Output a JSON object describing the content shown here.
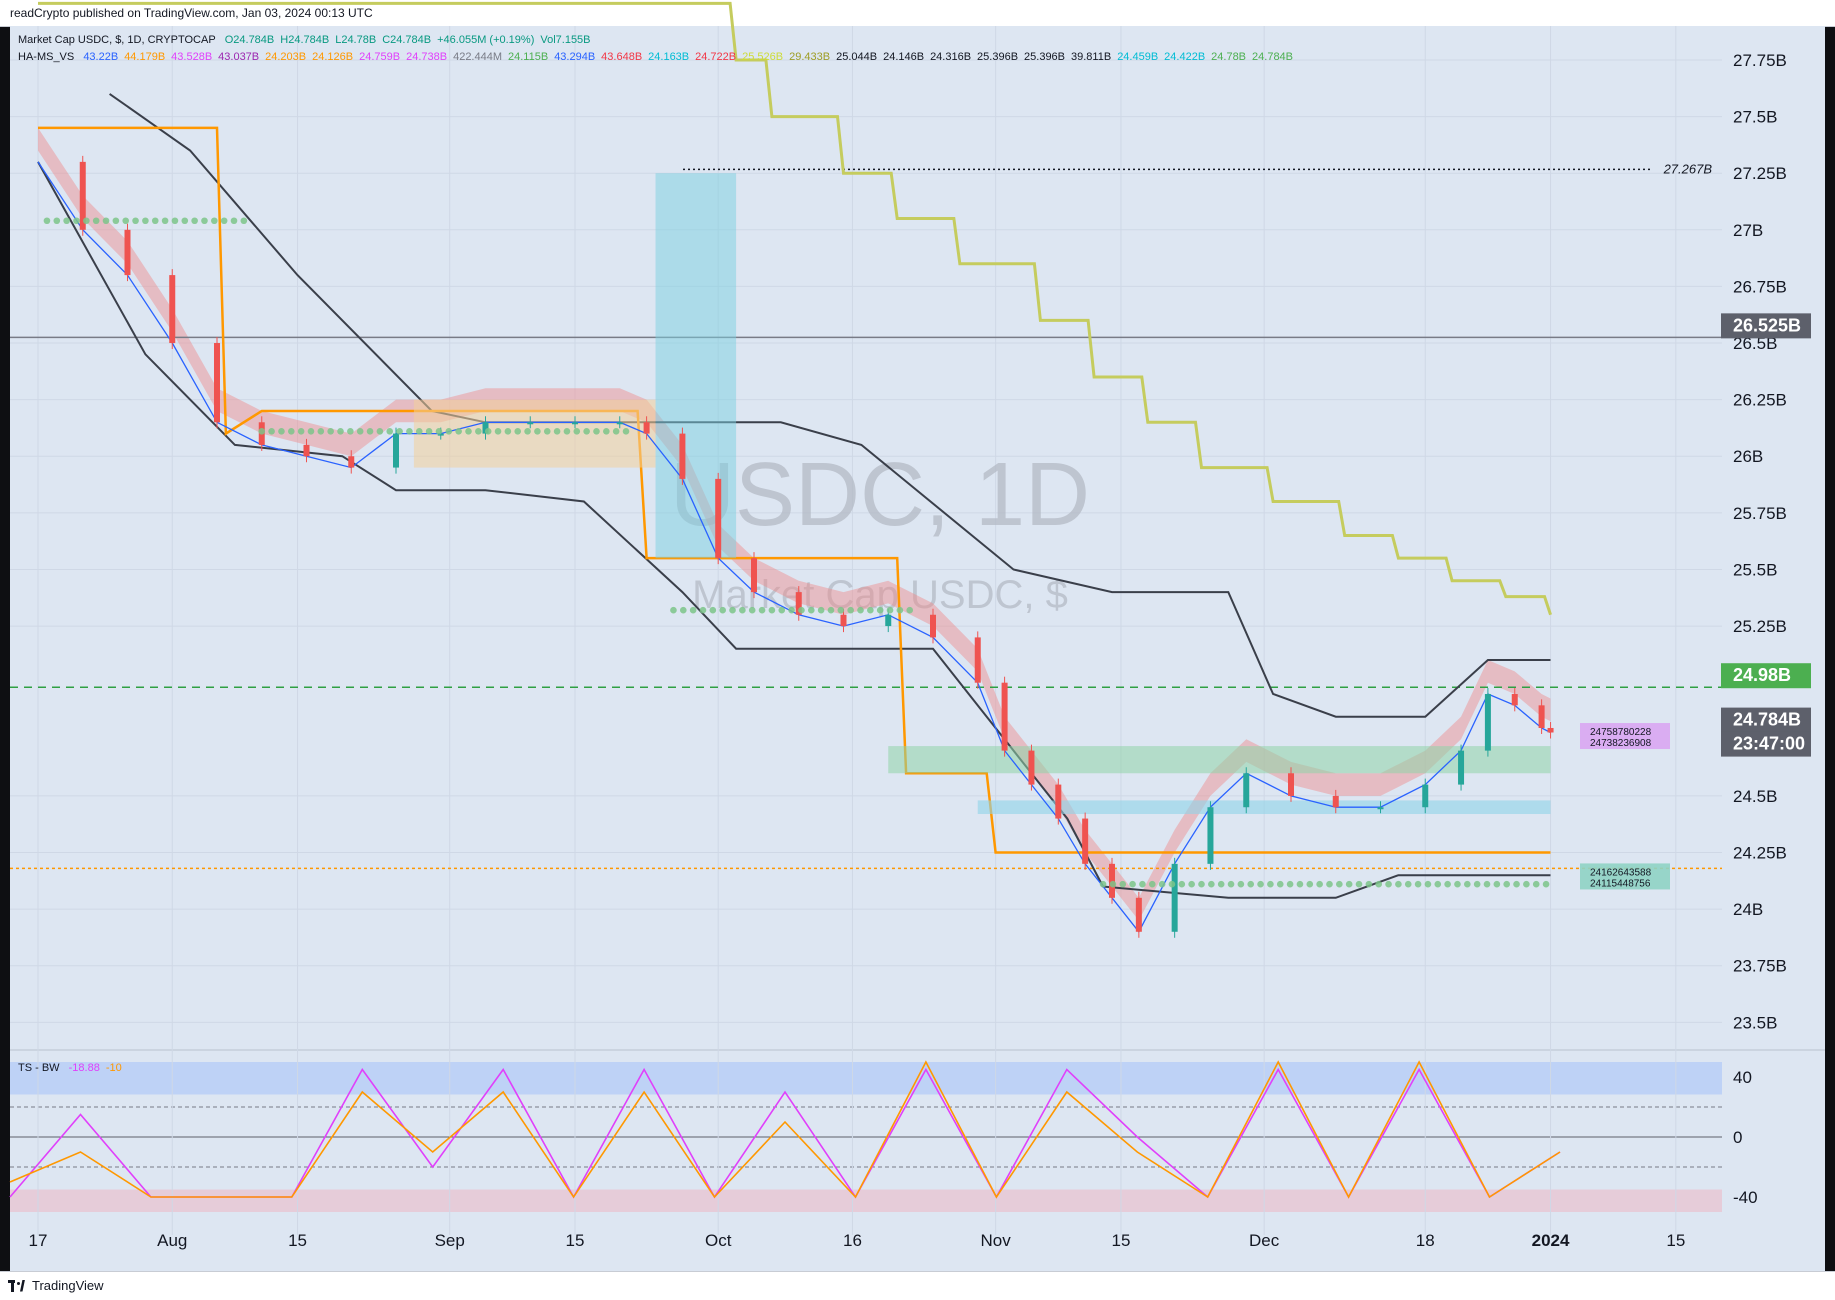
{
  "header": {
    "published": "readCrypto published on TradingView.com, Jan 03, 2024 00:13 UTC"
  },
  "footer": {
    "brand": "TradingView"
  },
  "legend": {
    "symbol": "Market Cap USDC, $, 1D, CRYPTOCAP",
    "ohlc": [
      "O24.784B",
      "H24.784B",
      "L24.78B",
      "C24.784B",
      "+46.055M (+0.19%)",
      "Vol7.155B"
    ],
    "indicator_name": "HA-MS_VS",
    "indicator_values": [
      {
        "text": "43.22B",
        "color": "#2962ff"
      },
      {
        "text": "44.179B",
        "color": "#ff9800"
      },
      {
        "text": "43.528B",
        "color": "#e040fb"
      },
      {
        "text": "43.037B",
        "color": "#9c27b0"
      },
      {
        "text": "24.203B",
        "color": "#ff9800"
      },
      {
        "text": "24.126B",
        "color": "#ff9800"
      },
      {
        "text": "24.759B",
        "color": "#e040fb"
      },
      {
        "text": "24.738B",
        "color": "#e040fb"
      },
      {
        "text": "422.444M",
        "color": "#787b86"
      },
      {
        "text": "24.115B",
        "color": "#4caf50"
      },
      {
        "text": "43.294B",
        "color": "#2962ff"
      },
      {
        "text": "43.648B",
        "color": "#f23645"
      },
      {
        "text": "24.163B",
        "color": "#00bcd4"
      },
      {
        "text": "24.722B",
        "color": "#f23645"
      },
      {
        "text": "25.526B",
        "color": "#cddc39"
      },
      {
        "text": "29.433B",
        "color": "#9e9d24"
      },
      {
        "text": "25.044B",
        "color": "#131722"
      },
      {
        "text": "24.146B",
        "color": "#131722"
      },
      {
        "text": "24.316B",
        "color": "#131722"
      },
      {
        "text": "25.396B",
        "color": "#131722"
      },
      {
        "text": "25.396B",
        "color": "#131722"
      },
      {
        "text": "39.811B",
        "color": "#131722"
      },
      {
        "text": "24.459B",
        "color": "#00bcd4"
      },
      {
        "text": "24.422B",
        "color": "#00bcd4"
      },
      {
        "text": "24.78B",
        "color": "#4caf50"
      },
      {
        "text": "24.784B",
        "color": "#4caf50"
      }
    ]
  },
  "watermark": {
    "symbol": "USDC, 1D",
    "name": "Market Cap USDC, $"
  },
  "oscillator_legend": {
    "name": "TS - BW",
    "values": [
      {
        "text": "-18.88",
        "color": "#e040fb"
      },
      {
        "text": "-10",
        "color": "#ff9800"
      }
    ]
  },
  "colors": {
    "up_candle": "#26a69a",
    "down_candle": "#ef5350",
    "price_badge": "#5d606b",
    "green_badge": "#4caf50",
    "resistance_line": "#787b86",
    "orange_line": "#ff9800",
    "olive_line": "#c5cc5e",
    "dark_line": "#3a3f4a"
  },
  "chart_data": [
    {
      "type": "line",
      "title": "Market Cap USDC, $, 1D, CRYPTOCAP",
      "xlabel": "",
      "ylabel": "",
      "ylim": [
        23.4,
        27.9
      ],
      "yticks": [
        "27.75B",
        "27.5B",
        "27.25B",
        "27B",
        "26.75B",
        "26.5B",
        "26.25B",
        "26B",
        "25.75B",
        "25.5B",
        "25.25B",
        "24.5B",
        "24.25B",
        "24B",
        "23.75B",
        "23.5B"
      ],
      "x_labels": [
        {
          "label": "17",
          "day": 0
        },
        {
          "label": "Aug",
          "day": 15
        },
        {
          "label": "15",
          "day": 29
        },
        {
          "label": "Sep",
          "day": 46
        },
        {
          "label": "15",
          "day": 60
        },
        {
          "label": "Oct",
          "day": 76
        },
        {
          "label": "16",
          "day": 91
        },
        {
          "label": "Nov",
          "day": 107
        },
        {
          "label": "15",
          "day": 121
        },
        {
          "label": "Dec",
          "day": 137
        },
        {
          "label": "18",
          "day": 155
        },
        {
          "label": "2024",
          "day": 169
        },
        {
          "label": "15",
          "day": 183
        }
      ],
      "series": [
        {
          "x": [
            0,
            5,
            10,
            15,
            20,
            25,
            30,
            35,
            40,
            45,
            50,
            55,
            60,
            65,
            68,
            72,
            76,
            80,
            85,
            90,
            95,
            100,
            105,
            108,
            111,
            114,
            117,
            120,
            123,
            127,
            131,
            135,
            140,
            145,
            150,
            155,
            159,
            162,
            165,
            168,
            169
          ],
          "values": [
            27.3,
            27.0,
            26.8,
            26.5,
            26.15,
            26.05,
            26.0,
            25.95,
            26.1,
            26.1,
            26.15,
            26.15,
            26.15,
            26.15,
            26.1,
            25.9,
            25.55,
            25.4,
            25.3,
            25.25,
            25.3,
            25.2,
            25.0,
            24.7,
            24.55,
            24.4,
            24.2,
            24.05,
            23.9,
            24.2,
            24.45,
            24.6,
            24.5,
            24.45,
            24.45,
            24.55,
            24.7,
            24.95,
            24.9,
            24.8,
            24.78
          ]
        }
      ],
      "horizontal_levels": [
        {
          "value": 27.267,
          "label": "27.267B",
          "style": "dotted"
        },
        {
          "value": 26.525,
          "label": "26.525B",
          "style": "solid"
        },
        {
          "value": 24.98,
          "label": "24.98B",
          "style": "dashed-green"
        },
        {
          "value": 24.18,
          "label": "",
          "style": "dotted-orange"
        }
      ],
      "badges": [
        {
          "value": 26.525,
          "text": "26.525B"
        },
        {
          "value": 24.98,
          "text": "24.98B"
        },
        {
          "value": 24.784,
          "text": "24.784B"
        },
        {
          "value": 24.784,
          "text": "23:47:00",
          "sub": true
        }
      ],
      "marker_labels": [
        {
          "value": 24.76,
          "lines": [
            "24758780228",
            "24738236908"
          ]
        },
        {
          "value": 24.14,
          "lines": [
            "24162643588",
            "24115448756"
          ]
        }
      ]
    },
    {
      "type": "line",
      "title": "TS - BW",
      "ylim": [
        -50,
        50
      ],
      "yticks": [
        "40",
        "0",
        "-40"
      ],
      "series": [
        {
          "name": "",
          "values": [
            -40,
            15,
            -40,
            -40,
            -40,
            45,
            -20,
            45,
            -40,
            45,
            -40,
            30,
            -40,
            45,
            -40,
            45,
            0,
            -40,
            45,
            -40,
            45,
            -40,
            -10
          ]
        },
        {
          "name": "",
          "values": [
            -30,
            -10,
            -40,
            -40,
            -40,
            30,
            -10,
            30,
            -40,
            30,
            -40,
            10,
            -40,
            50,
            -40,
            30,
            -10,
            -40,
            50,
            -40,
            50,
            -40,
            -10
          ]
        }
      ]
    }
  ]
}
